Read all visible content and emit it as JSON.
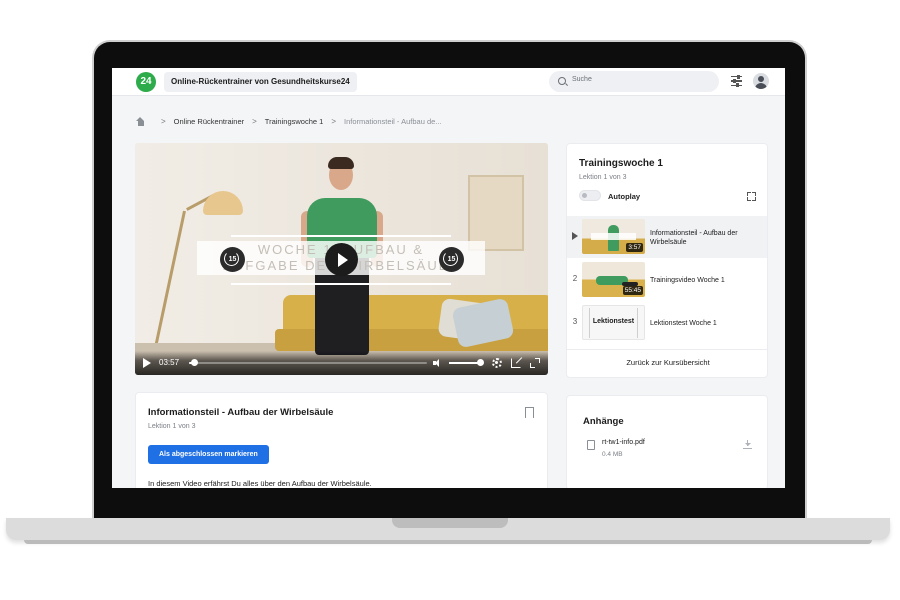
{
  "header": {
    "logo_text": "24",
    "brand": "Online-Rückentrainer von Gesundheitskurse24",
    "search_placeholder": "Suche"
  },
  "breadcrumb": {
    "items": [
      "Online Rückentrainer",
      "Trainingswoche 1",
      "Informationsteil - Aufbau de..."
    ],
    "separator": ">"
  },
  "video": {
    "overlay_text_line1": "WOCHE 1: AUFBAU &",
    "overlay_text_line2": "AUFGABE DER WIRBELSÄULE",
    "skip_back_label": "15",
    "skip_forward_label": "15",
    "current_time": "03:57",
    "progress_fraction": 0.02,
    "volume_fraction": 0.9
  },
  "playlist": {
    "title": "Trainingswoche 1",
    "subtitle": "Lektion 1 von 3",
    "autoplay_label": "Autoplay",
    "autoplay_on": false,
    "items": [
      {
        "marker": "",
        "title": "Informationsteil - Aufbau der Wirbelsäule",
        "duration": "3:57",
        "active": true
      },
      {
        "marker": "2",
        "title": "Trainingsvideo Woche 1",
        "duration": "55:45",
        "active": false
      },
      {
        "marker": "3",
        "title": "Lektionstest Woche 1",
        "thumb_label": "Lektionstest",
        "active": false
      }
    ],
    "back_label": "Zurück zur Kursübersicht"
  },
  "lesson": {
    "title": "Informationsteil - Aufbau der Wirbelsäule",
    "subtitle": "Lektion 1 von 3",
    "mark_button": "Als abgeschlossen markieren",
    "description": "In diesem Video erfährst Du alles über den Aufbau der Wirbelsäule."
  },
  "attachments": {
    "title": "Anhänge",
    "files": [
      {
        "name": "rt-tw1-info.pdf",
        "size": "0.4 MB"
      }
    ]
  },
  "colors": {
    "brand_green": "#2eab4a",
    "primary_blue": "#1f6fe5"
  }
}
